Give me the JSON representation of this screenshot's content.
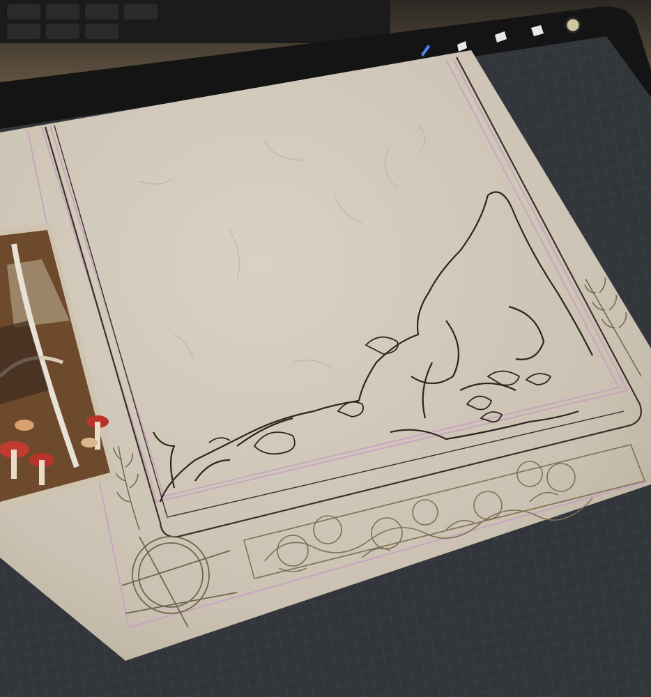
{
  "scene": {
    "description_tags": [
      "drawing-tablet",
      "illustration-canvas",
      "reference-image",
      "keyboard"
    ]
  },
  "colors": {
    "desk": "#2a2622",
    "keyboard": "#1c1c1e",
    "bezel": "#151516",
    "screen_grid_bg": "#3a3e44",
    "grid_line": "#4b5058",
    "paper": "#cfc6b8",
    "paper_shadow": "#b9afa0",
    "ink": "#2b251e",
    "guide_pink": "#c79bbf",
    "ornament_gold": "#8a7d5c",
    "mushroom_red": "#b8342b",
    "reference_bg": "#6b4a2f"
  },
  "icons": [
    "brush-icon",
    "smudge-icon",
    "eraser-icon",
    "layers-icon",
    "color-icon"
  ]
}
